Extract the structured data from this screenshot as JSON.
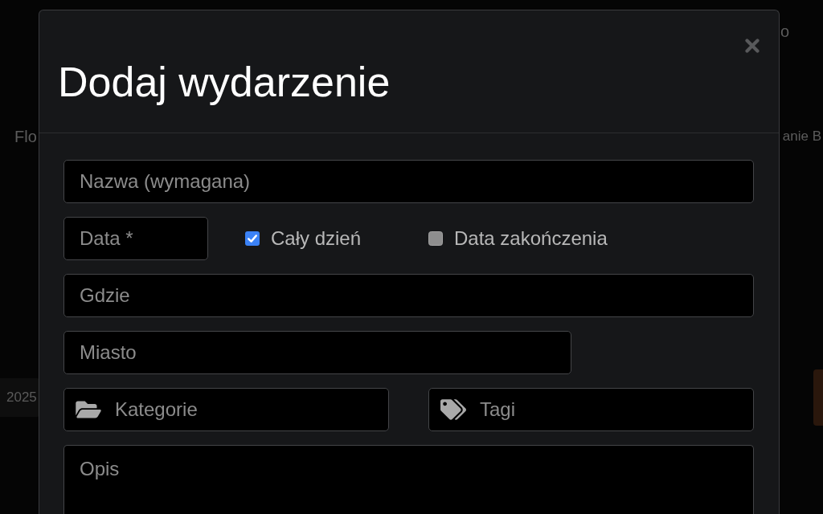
{
  "background": {
    "top_text": "o",
    "banner": {
      "left_text": "Flo",
      "right_text": "anie B"
    },
    "year": "2025"
  },
  "dialog": {
    "title": "Dodaj wydarzenie",
    "form": {
      "name_field": {
        "placeholder": "Nazwa (wymagana)"
      },
      "date_field": {
        "placeholder": "Data *"
      },
      "options": [
        {
          "label": "Cały dzień",
          "checked": true
        },
        {
          "label": "Data zakończenia",
          "checked": false
        }
      ],
      "where_field": {
        "placeholder": "Gdzie"
      },
      "city_field": {
        "placeholder": "Miasto"
      },
      "category_field": {
        "placeholder": "Kategorie"
      },
      "tags_field": {
        "placeholder": "Tagi"
      },
      "description_field": {
        "placeholder": "Opis"
      }
    }
  }
}
